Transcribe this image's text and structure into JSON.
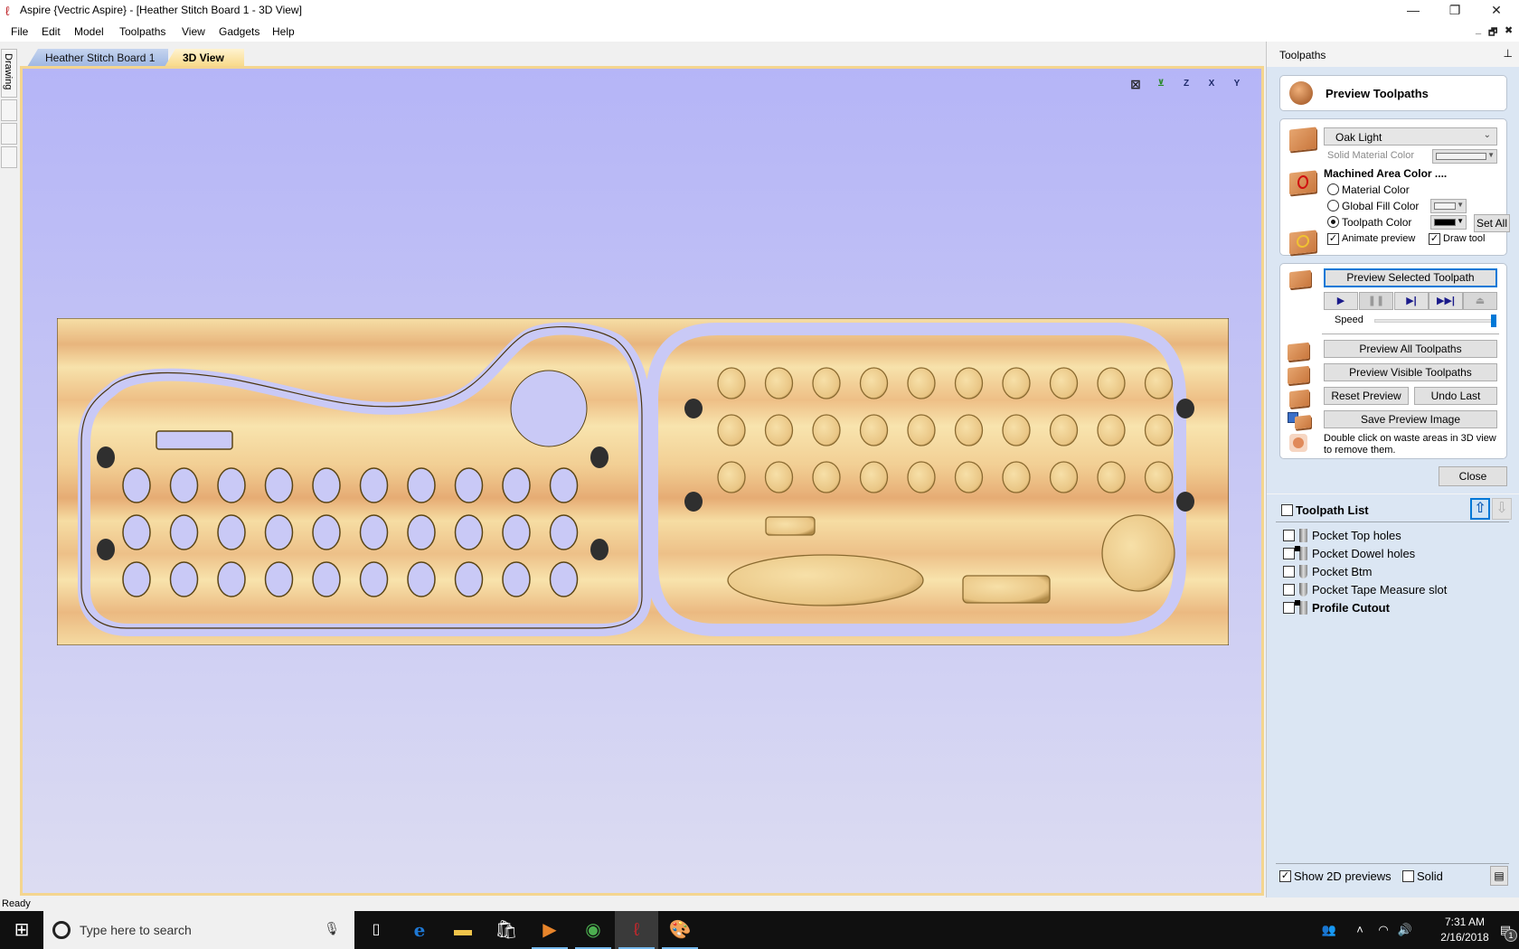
{
  "window": {
    "title": "Aspire {Vectric Aspire} - [Heather Stitch Board 1 - 3D View]",
    "controls": {
      "minimize": "—",
      "restore": "❐",
      "close": "✕"
    },
    "mdi_controls": {
      "minimize": "_",
      "restore": "🗗",
      "close": "✖"
    }
  },
  "menu": [
    "File",
    "Edit",
    "Model",
    "Toolpaths",
    "View",
    "Gadgets",
    "Help"
  ],
  "left_tabs": [
    "Drawing",
    "",
    "",
    ""
  ],
  "doc_tabs": [
    {
      "label": "Heather Stitch Board 1",
      "active": false
    },
    {
      "label": "3D View",
      "active": true
    }
  ],
  "view3d": {
    "view_buttons": [
      {
        "name": "zoom-extents",
        "glyph": "⊠"
      },
      {
        "name": "iso-view",
        "glyph": "⊻"
      },
      {
        "name": "top-view",
        "glyph": "Z"
      },
      {
        "name": "front-view",
        "glyph": "X"
      },
      {
        "name": "side-view",
        "glyph": "Y"
      }
    ],
    "material": "Oak Light",
    "left_part": {
      "through_hole_rows": 3,
      "through_hole_cols": 10,
      "dowel_holes": 4
    },
    "right_part": {
      "pocket_rows": 3,
      "pocket_cols": 10,
      "dowel_holes": 4
    }
  },
  "panel": {
    "title": "Toolpaths",
    "pin_glyph": "⊥",
    "header": "Preview Toolpaths",
    "material": {
      "selected": "Oak Light",
      "solid_material_color_label": "Solid Material Color",
      "machined_area_label": "Machined Area Color ....",
      "options": [
        "Material Color",
        "Global Fill Color",
        "Toolpath Color"
      ],
      "selected_option": "Toolpath Color",
      "toolpath_color": "#000000",
      "set_all": "Set All",
      "animate_preview": {
        "label": "Animate preview",
        "checked": true
      },
      "draw_tool": {
        "label": "Draw tool",
        "checked": true
      }
    },
    "preview": {
      "preview_selected": "Preview Selected Toolpath",
      "playback": [
        {
          "name": "play",
          "glyph": "▶",
          "enabled": true
        },
        {
          "name": "pause",
          "glyph": "❚❚",
          "enabled": false
        },
        {
          "name": "step",
          "glyph": "▶|",
          "enabled": true
        },
        {
          "name": "fast-forward",
          "glyph": "▶▶|",
          "enabled": true
        },
        {
          "name": "eject",
          "glyph": "⏏",
          "enabled": false
        }
      ],
      "speed_label": "Speed",
      "speed_value": 1.0,
      "preview_all": "Preview All Toolpaths",
      "preview_visible": "Preview Visible Toolpaths",
      "reset_preview": "Reset Preview",
      "undo_last": "Undo Last",
      "save_preview_image": "Save Preview Image",
      "hint": "Double click on waste areas in 3D view to remove them."
    },
    "close": "Close",
    "toolpath_list": {
      "title": "Toolpath List",
      "items": [
        {
          "name": "Pocket Top holes",
          "checked": false,
          "bold": false
        },
        {
          "name": "Pocket Dowel holes",
          "checked": false,
          "bold": false
        },
        {
          "name": "Pocket Btm",
          "checked": false,
          "bold": false
        },
        {
          "name": "Pocket Tape Measure slot",
          "checked": false,
          "bold": false
        },
        {
          "name": "Profile Cutout",
          "checked": false,
          "bold": true
        }
      ]
    },
    "show_2d_previews": {
      "label": "Show 2D previews",
      "checked": true
    },
    "solid": {
      "label": "Solid",
      "checked": false
    }
  },
  "status": "Ready",
  "taskbar": {
    "search_placeholder": "Type here to search",
    "apps": [
      "task-view",
      "edge",
      "file-explorer",
      "store",
      "media-player",
      "chrome",
      "aspire",
      "paint"
    ],
    "time": "7:31 AM",
    "date": "2/16/2018",
    "notifications": "1"
  },
  "colors": {
    "view_border": "#f4d58f",
    "panel_bg": "#dbe6f3",
    "accent": "#0078d7",
    "wood_light": "#f3d9a0",
    "wood_dark": "#e0a56a",
    "cut_through": "#c9c9f6"
  }
}
